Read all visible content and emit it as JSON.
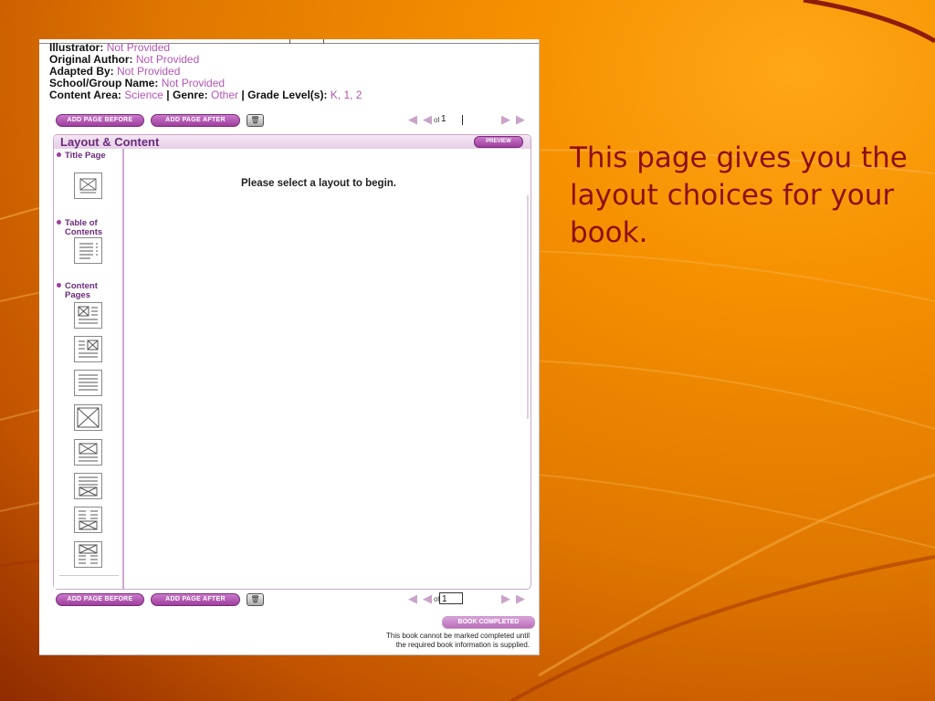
{
  "metadata": {
    "illustrator_label": "Illustrator:",
    "illustrator_value": "Not Provided",
    "original_author_label": "Original Author:",
    "original_author_value": "Not Provided",
    "adapted_by_label": "Adapted By:",
    "adapted_by_value": "Not Provided",
    "school_label": "School/Group Name:",
    "school_value": "Not Provided",
    "content_area_label": "Content Area:",
    "content_area_value": "Science",
    "genre_label": "Genre:",
    "genre_value": "Other",
    "grade_label": "Grade Level(s):",
    "grade_value": "K, 1, 2",
    "separator": "|"
  },
  "toolbar": {
    "add_before_label": "Add Page Before",
    "add_after_label": "Add Page After",
    "delete_icon": "trash-icon",
    "of_label": "of",
    "page_value": "1"
  },
  "panel": {
    "title": "Layout & Content",
    "preview_label": "Preview",
    "message": "Please select a layout to begin."
  },
  "sidebar": {
    "categories": [
      {
        "label": "Title Page"
      },
      {
        "label": "Table of Contents"
      },
      {
        "label": "Content Pages"
      }
    ]
  },
  "footer": {
    "book_completed_label": "Book Completed",
    "notice_line1": "This book cannot be marked completed until",
    "notice_line2": "the required book information is supplied."
  },
  "caption": {
    "text": "This page gives you the layout choices for your book."
  },
  "colors": {
    "accent": "#9e3f9e",
    "value_text": "#b355b3",
    "caption_text": "#8e0f0f"
  }
}
